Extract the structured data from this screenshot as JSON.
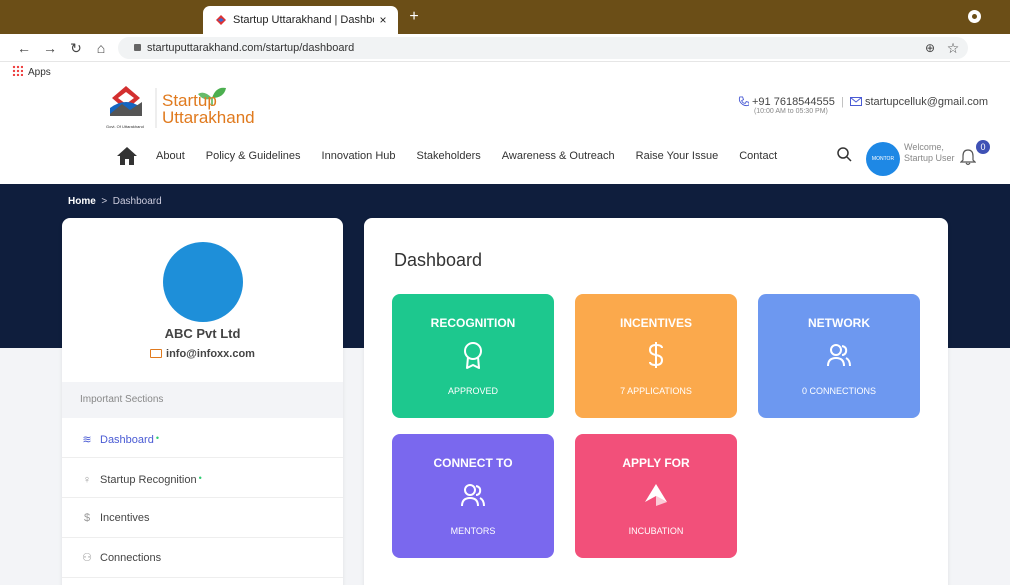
{
  "browser": {
    "tab_title": "Startup Uttarakhand | Dashboard",
    "tab_close": "×",
    "new_tab": "+",
    "url": "startuputtarakhand.com/startup/dashboard",
    "bookmarks_apps": "Apps"
  },
  "header": {
    "logo_line1": "Startup",
    "logo_line2": "Uttarakhand",
    "logo_seal_text": "Govt. Of Uttarakhand",
    "phone": "+91 7618544555",
    "hours": "(10:00 AM to 05:30 PM)",
    "email": "startupcelluk@gmail.com",
    "nav": [
      "About",
      "Policy & Guidelines",
      "Innovation Hub",
      "Stakeholders",
      "Awareness & Outreach",
      "Raise Your Issue",
      "Contact"
    ],
    "avatar_text": "MONTOR",
    "welcome_line1": "Welcome,",
    "welcome_line2": "Startup User",
    "notification_count": "0"
  },
  "breadcrumb": {
    "home": "Home",
    "sep": ">",
    "current": "Dashboard"
  },
  "profile": {
    "company": "ABC Pvt Ltd",
    "email": "info@infoxx.com",
    "sections_title": "Important Sections",
    "items": [
      {
        "label": "Dashboard",
        "icon": "layers-icon",
        "dot": "•"
      },
      {
        "label": "Startup Recognition",
        "icon": "award-icon",
        "dot": "•"
      },
      {
        "label": "Incentives",
        "icon": "dollar-icon",
        "dot": ""
      },
      {
        "label": "Connections",
        "icon": "users-icon",
        "dot": ""
      }
    ]
  },
  "dashboard": {
    "title": "Dashboard",
    "tiles": [
      {
        "title": "RECOGNITION",
        "sub": "APPROVED",
        "color": "#1dc88e"
      },
      {
        "title": "INCENTIVES",
        "sub": "7 APPLICATIONS",
        "color": "#fba94c"
      },
      {
        "title": "NETWORK",
        "sub": "0 CONNECTIONS",
        "color": "#6d98f0"
      },
      {
        "title": "CONNECT TO",
        "sub": "MENTORS",
        "color": "#7a68ee"
      },
      {
        "title": "APPLY FOR",
        "sub": "INCUBATION",
        "color": "#f2507a"
      }
    ]
  }
}
